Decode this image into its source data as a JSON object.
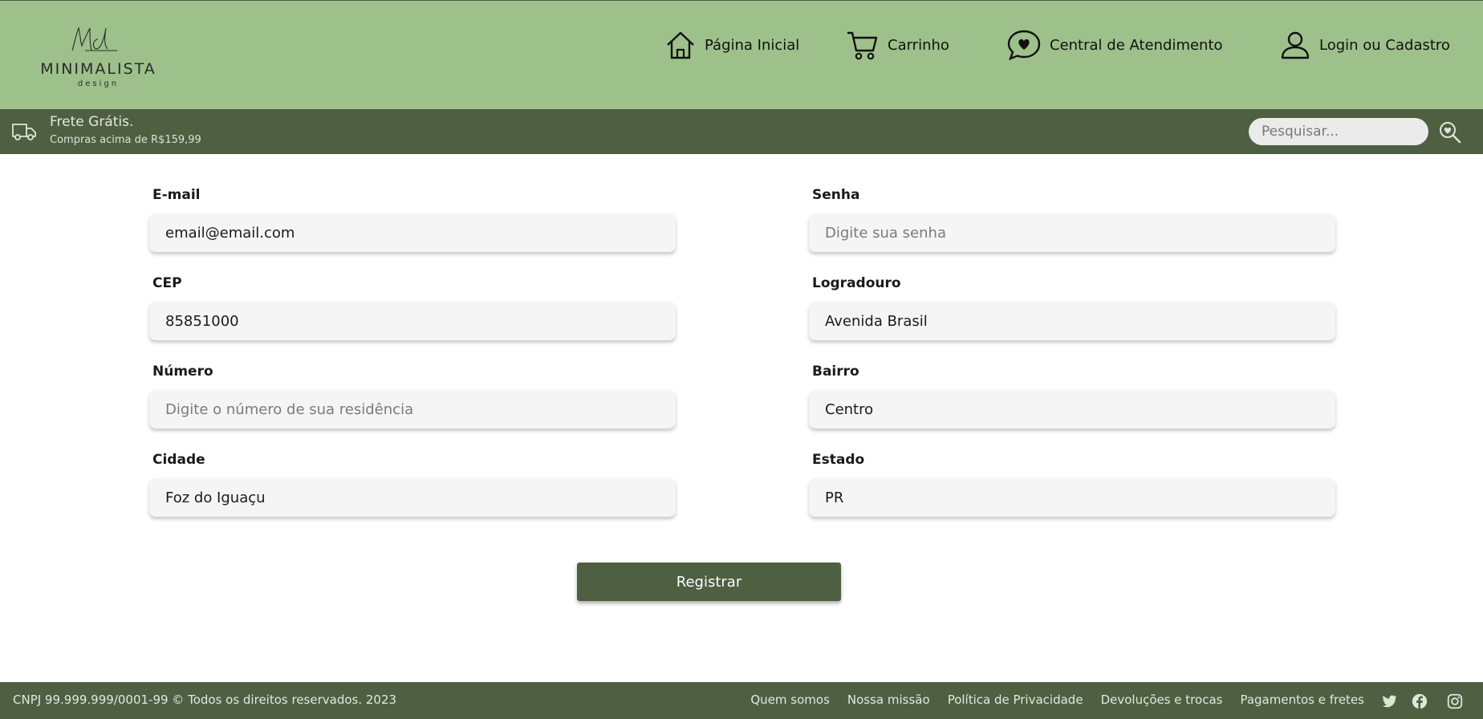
{
  "header": {
    "logo": {
      "script": "Md",
      "brand": "MINIMALISTA",
      "sub": "design"
    },
    "nav": [
      {
        "label": "Página Inicial",
        "icon": "home-icon"
      },
      {
        "label": "Carrinho",
        "icon": "cart-icon"
      },
      {
        "label": "Central de Atendimento",
        "icon": "chat-heart-icon"
      },
      {
        "label": "Login ou Cadastro",
        "icon": "user-icon"
      }
    ]
  },
  "promo": {
    "title": "Frete Grátis.",
    "subtitle": "Compras acima de R$159,99",
    "icon": "truck-icon"
  },
  "search": {
    "placeholder": "Pesquisar...",
    "icon": "search-heart-icon"
  },
  "form": {
    "email": {
      "label": "E-mail",
      "value": "email@email.com",
      "placeholder": ""
    },
    "password": {
      "label": "Senha",
      "value": "",
      "placeholder": "Digite sua senha"
    },
    "cep": {
      "label": "CEP",
      "value": "85851000",
      "placeholder": ""
    },
    "street": {
      "label": "Logradouro",
      "value": "Avenida Brasil",
      "placeholder": ""
    },
    "number": {
      "label": "Número",
      "value": "",
      "placeholder": "Digite o número de sua residência"
    },
    "district": {
      "label": "Bairro",
      "value": "Centro",
      "placeholder": ""
    },
    "city": {
      "label": "Cidade",
      "value": "Foz do Iguaçu",
      "placeholder": ""
    },
    "state": {
      "label": "Estado",
      "value": "PR",
      "placeholder": ""
    },
    "submit_label": "Registrar"
  },
  "footer": {
    "copyright": "CNPJ 99.999.999/0001-99 © Todos os direitos reservados. 2023",
    "links": [
      "Quem somos",
      "Nossa missão",
      "Política de Privacidade",
      "Devoluções e trocas",
      "Pagamentos e fretes"
    ],
    "social": [
      "twitter-icon",
      "facebook-icon",
      "instagram-icon"
    ]
  },
  "colors": {
    "header_bg": "#9ec18b",
    "dark_green": "#4e5f42",
    "input_bg": "#f5f5f5"
  }
}
